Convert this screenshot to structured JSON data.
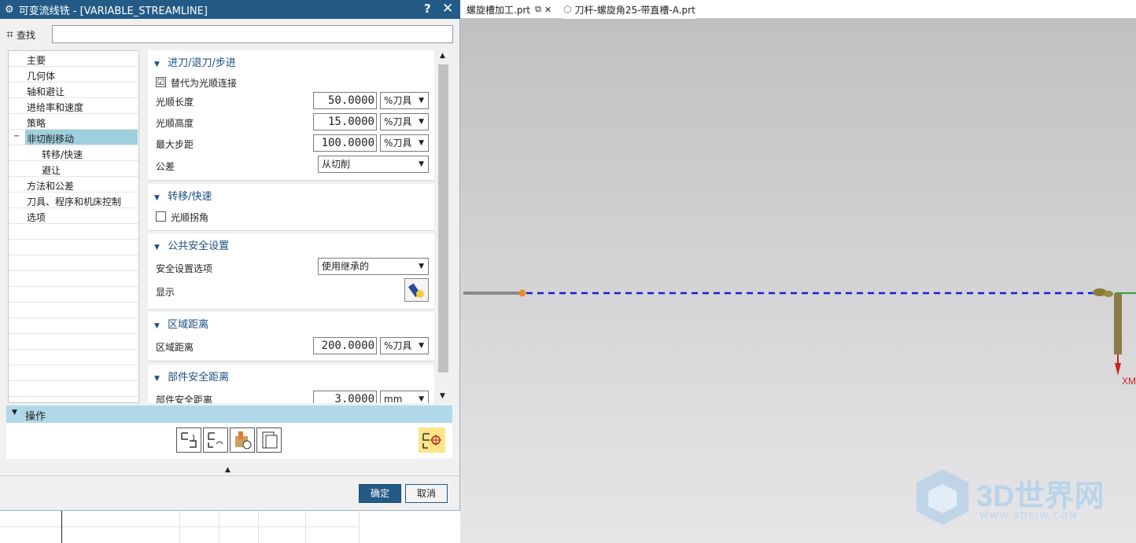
{
  "dialog": {
    "title": "可变流线铣 - [VARIABLE_STREAMLINE]",
    "help": "?",
    "close": "✕",
    "find_label": "查找",
    "find_value": ""
  },
  "tree": {
    "items": [
      {
        "label": "主要"
      },
      {
        "label": "几何体"
      },
      {
        "label": "轴和避让"
      },
      {
        "label": "进给率和速度"
      },
      {
        "label": "策略"
      },
      {
        "label": "非切削移动"
      },
      {
        "label": "转移/快速"
      },
      {
        "label": "避让"
      },
      {
        "label": "方法和公差"
      },
      {
        "label": "刀具、程序和机床控制"
      },
      {
        "label": "选项"
      }
    ],
    "expand_glyph": "−"
  },
  "settings": {
    "sec1": {
      "title": "进刀/退刀/步进",
      "smooth_check": "替代为光顺连接",
      "smooth_checked": "☑",
      "len_label": "光顺长度",
      "len_value": "50.0000",
      "len_unit": "%刀具",
      "height_label": "光顺高度",
      "height_value": "15.0000",
      "height_unit": "%刀具",
      "step_label": "最大步距",
      "step_value": "100.0000",
      "step_unit": "%刀具",
      "tol_label": "公差",
      "tol_value": "从切削"
    },
    "sec2": {
      "title": "转移/快速",
      "corner_check": "光顺拐角"
    },
    "sec3": {
      "title": "公共安全设置",
      "opt_label": "安全设置选项",
      "opt_value": "使用继承的",
      "disp_label": "显示"
    },
    "sec4": {
      "title": "区域距离",
      "label": "区域距离",
      "value": "200.0000",
      "unit": "%刀具"
    },
    "sec5": {
      "title": "部件安全距离",
      "label": "部件安全距离",
      "value": "3.0000",
      "unit": "mm"
    }
  },
  "ops": {
    "title": "操作"
  },
  "buttons": {
    "ok": "确定",
    "cancel": "取消"
  },
  "file_tabs": [
    {
      "label": "螺旋槽加工.prt"
    },
    {
      "label": "刀杆-螺旋角25-带直槽-A.prt"
    }
  ],
  "viewport": {
    "axis_label": "XM"
  },
  "watermark": {
    "title": "3D世界网",
    "url": "WWW.3DSJW.COM"
  },
  "colors": {
    "title_bar": "#235b86",
    "selection": "#9ecfdc",
    "section_header": "#1a4f80",
    "toolpath": "#1a1adc"
  }
}
